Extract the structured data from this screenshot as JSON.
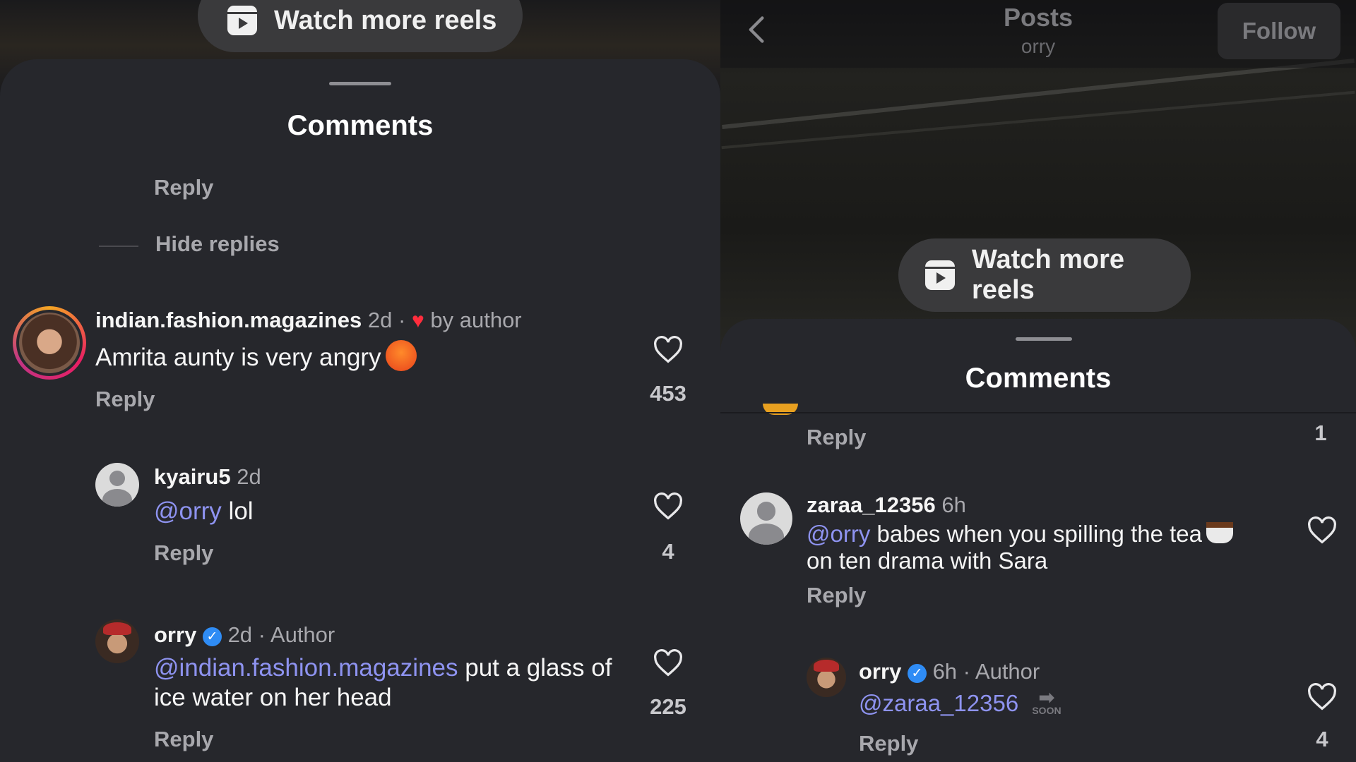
{
  "left": {
    "watch_more": "Watch more reels",
    "sheet_title": "Comments",
    "top_reply": "Reply",
    "hide_replies": "Hide replies",
    "comments": [
      {
        "username": "indian.fashion.magazines",
        "time": "2d",
        "sep": "·",
        "badge": "by author",
        "text": "Amrita aunty is very angry",
        "reply": "Reply",
        "likes": "453"
      },
      {
        "username": "kyairu5",
        "time": "2d",
        "mention": "@orry",
        "text": " lol",
        "reply": "Reply",
        "likes": "4"
      },
      {
        "username": "orry",
        "verified": "✓",
        "time": "2d",
        "sep": "·",
        "role": "Author",
        "mention": "@indian.fashion.magazines",
        "text": " put a glass of ice water on her head",
        "reply": "Reply",
        "likes": "225"
      }
    ]
  },
  "right": {
    "title": "Posts",
    "subtitle": "orry",
    "follow": "Follow",
    "watch_more": "Watch more reels",
    "sheet_title": "Comments",
    "top_reply": "Reply",
    "top_likes": "1",
    "comments": [
      {
        "username": "zaraa_12356",
        "time": "6h",
        "mention": "@orry",
        "text": " babes when you spilling the tea",
        "text2": "on ten drama with Sara",
        "reply": "Reply"
      },
      {
        "username": "orry",
        "verified": "✓",
        "time": "6h",
        "sep": "·",
        "role": "Author",
        "mention": "@zaraa_12356",
        "soon": "SOON",
        "reply": "Reply",
        "likes": "4"
      }
    ]
  },
  "icons": {
    "reel": "reels-icon",
    "heart": "heart-outline-icon",
    "back": "chevron-left-icon",
    "verified": "verified-badge-icon"
  },
  "colors": {
    "sheet_bg": "#26272c",
    "mention": "#8e93f0",
    "verified": "#2f8cf5",
    "liked_heart": "#ff2d3d"
  }
}
